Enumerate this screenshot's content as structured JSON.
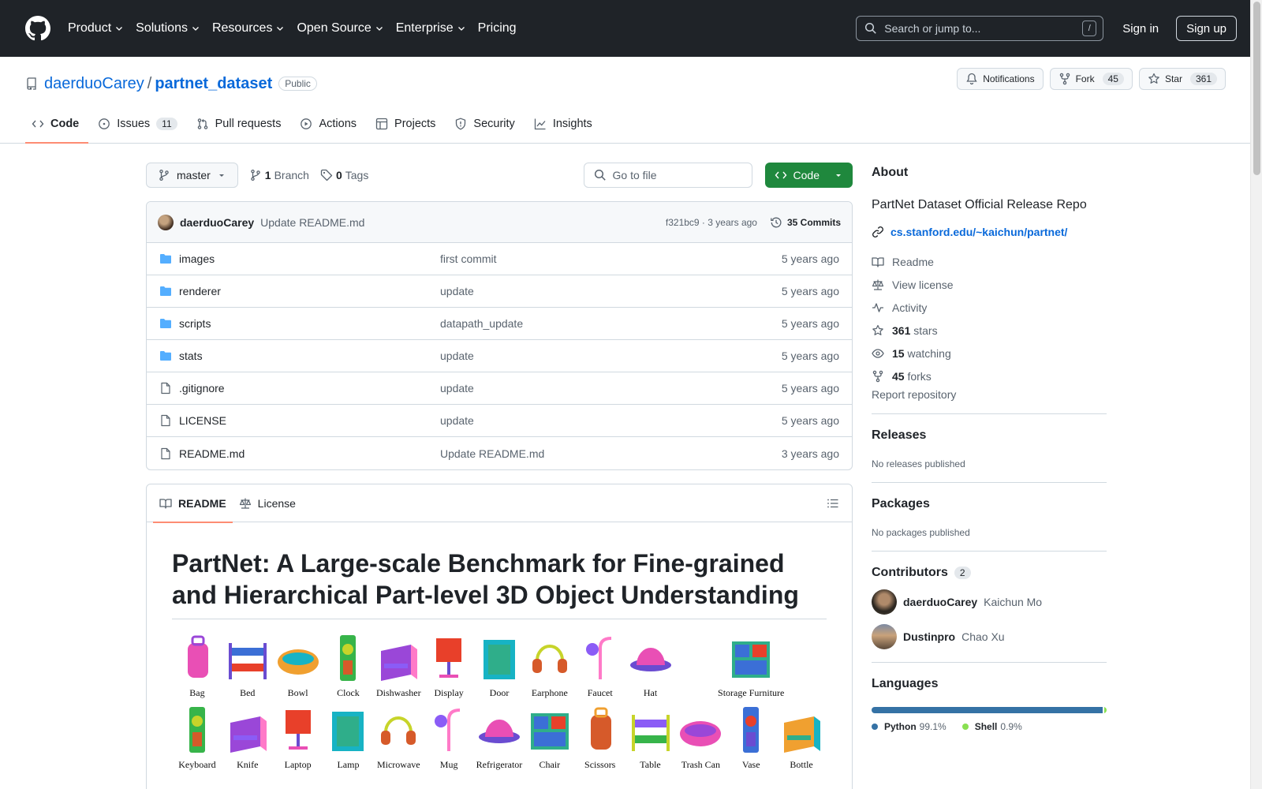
{
  "header": {
    "nav": [
      "Product",
      "Solutions",
      "Resources",
      "Open Source",
      "Enterprise",
      "Pricing"
    ],
    "search_placeholder": "Search or jump to...",
    "search_shortcut": "/",
    "sign_in": "Sign in",
    "sign_up": "Sign up"
  },
  "repo": {
    "owner": "daerduoCarey",
    "separator": "/",
    "name": "partnet_dataset",
    "visibility": "Public",
    "notifications_label": "Notifications",
    "fork_label": "Fork",
    "fork_count": "45",
    "star_label": "Star",
    "star_count": "361",
    "tabs": [
      {
        "label": "Code",
        "count": ""
      },
      {
        "label": "Issues",
        "count": "11"
      },
      {
        "label": "Pull requests",
        "count": ""
      },
      {
        "label": "Actions",
        "count": ""
      },
      {
        "label": "Projects",
        "count": ""
      },
      {
        "label": "Security",
        "count": ""
      },
      {
        "label": "Insights",
        "count": ""
      }
    ]
  },
  "toolbar": {
    "branch": "master",
    "branch_count": "1",
    "branch_label": "Branch",
    "tag_count": "0",
    "tag_label": "Tags",
    "goto_placeholder": "Go to file",
    "code_label": "Code"
  },
  "commit": {
    "author": "daerduoCarey",
    "message": "Update README.md",
    "hash_time": "f321bc9 · 3 years ago",
    "commits_label": "35 Commits"
  },
  "files": [
    {
      "name": "images",
      "type": "dir",
      "commit": "first commit",
      "date": "5 years ago"
    },
    {
      "name": "renderer",
      "type": "dir",
      "commit": "update",
      "date": "5 years ago"
    },
    {
      "name": "scripts",
      "type": "dir",
      "commit": "datapath_update",
      "date": "5 years ago"
    },
    {
      "name": "stats",
      "type": "dir",
      "commit": "update",
      "date": "5 years ago"
    },
    {
      "name": ".gitignore",
      "type": "file",
      "commit": "update",
      "date": "5 years ago"
    },
    {
      "name": "LICENSE",
      "type": "file",
      "commit": "update",
      "date": "5 years ago"
    },
    {
      "name": "README.md",
      "type": "file",
      "commit": "Update README.md",
      "date": "3 years ago"
    }
  ],
  "readme": {
    "tab_readme": "README",
    "tab_license": "License",
    "title": "PartNet: A Large-scale Benchmark for Fine-grained and Hierarchical Part-level 3D Object Understanding",
    "objects_row1": [
      "Bag",
      "Bed",
      "Bowl",
      "Clock",
      "Dishwasher",
      "Display",
      "Door",
      "Earphone",
      "Faucet",
      "Hat",
      "Storage Furniture"
    ],
    "objects_row2": [
      "Keyboard",
      "Knife",
      "Laptop",
      "Lamp",
      "Microwave",
      "Mug",
      "Refrigerator",
      "Chair",
      "Scissors",
      "Table",
      "Trash Can",
      "Vase",
      "Bottle"
    ]
  },
  "about": {
    "title": "About",
    "description": "PartNet Dataset Official Release Repo",
    "link": "cs.stanford.edu/~kaichun/partnet/",
    "items": [
      {
        "bold": "",
        "text": "Readme"
      },
      {
        "bold": "",
        "text": "View license"
      },
      {
        "bold": "",
        "text": "Activity"
      },
      {
        "bold": "361",
        "text": "stars"
      },
      {
        "bold": "15",
        "text": "watching"
      },
      {
        "bold": "45",
        "text": "forks"
      }
    ],
    "report": "Report repository"
  },
  "releases": {
    "title": "Releases",
    "empty": "No releases published"
  },
  "packages": {
    "title": "Packages",
    "empty": "No packages published"
  },
  "contributors": {
    "title": "Contributors",
    "count": "2",
    "list": [
      {
        "login": "daerduoCarey",
        "name": "Kaichun Mo"
      },
      {
        "login": "Dustinpro",
        "name": "Chao Xu"
      }
    ]
  },
  "languages": {
    "title": "Languages",
    "list": [
      {
        "name": "Python",
        "pct": "99.1%",
        "value": 99.1,
        "color": "#3572A5"
      },
      {
        "name": "Shell",
        "pct": "0.9%",
        "value": 0.9,
        "color": "#89e051"
      }
    ]
  }
}
